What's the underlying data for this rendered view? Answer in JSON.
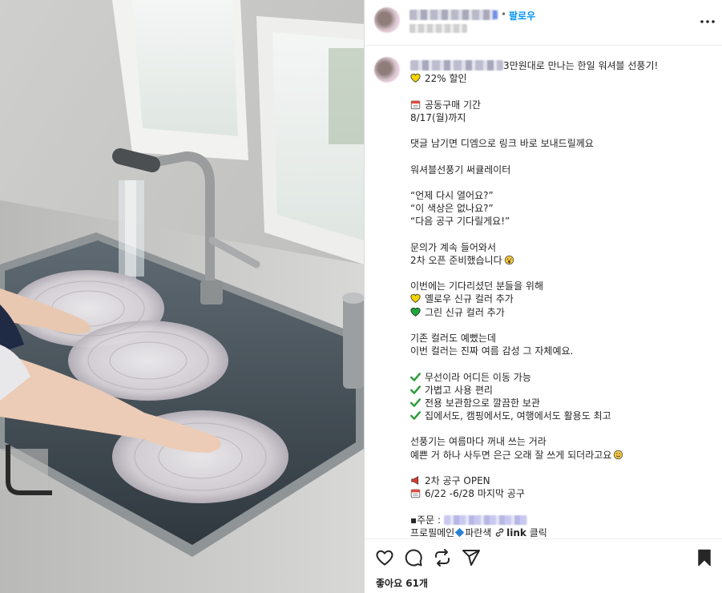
{
  "post": {
    "follow_label": "팔로우",
    "separator": "•",
    "more_label": "...",
    "likes_text": "좋아요 61개",
    "photo_alt": "싱크대에서 선풍기 부품을 세척하는 사진"
  },
  "caption": {
    "headline": "3만원대로 만나는 한일 워셔블 선풍기!",
    "discount": "22% 할인",
    "period_title": "공동구매 기간",
    "period_date": "8/17(월)까지",
    "comment_dm": "댓글 남기면 디엠으로 링크 바로 보내드릴께요",
    "product_name": "워셔블선풍기 써큘레이터",
    "quote1": "“언제 다시 열어요?”",
    "quote2": "“이 색상은 없나요?”",
    "quote3": "“다음 공구 기다릴게요!”",
    "inquiry1": "문의가 계속 들어와서",
    "inquiry2": "2차 오픈 준비했습니다",
    "new_intro": "이번에는 기다리셨던 분들을 위해",
    "new_yellow": "옐로우 신규 컬러 추가",
    "new_green": "그린 신규 컬러 추가",
    "color1": "기존 컬러도 예뻤는데",
    "color2": "이번 컬러는 진짜 여름 감성 그 자체예요.",
    "feature1": "무선이라 어디든 이동 가능",
    "feature2": "가볍고 사용 편리",
    "feature3": "전용 보관함으로 깔끔한 보관",
    "feature4": "집에서도, 캠핑에서도, 여행에서도 활용도 최고",
    "closing1": "선풍기는 여름마다 꺼내 쓰는 거라",
    "closing2": "예쁜 거 하나 사두면 은근 오래 잘 쓰게 되더라고요",
    "open_title": "2차 공구 OPEN",
    "open_dates": "6/22 -6/28 마지막 공구",
    "order_label": "▪주문 : ",
    "profile_prefix": "프로필메인",
    "profile_color": "파란색",
    "profile_link": "link",
    "profile_click": "클릭"
  },
  "colors": {
    "follow": "#0095f6",
    "text": "#262626",
    "check_green": "#2e9b3c",
    "heart_yellow": "#f5d400",
    "heart_green": "#1fa83a"
  },
  "icons": [
    "heart-icon",
    "comment-icon",
    "repost-icon",
    "share-icon",
    "bookmark-icon",
    "more-icon"
  ]
}
